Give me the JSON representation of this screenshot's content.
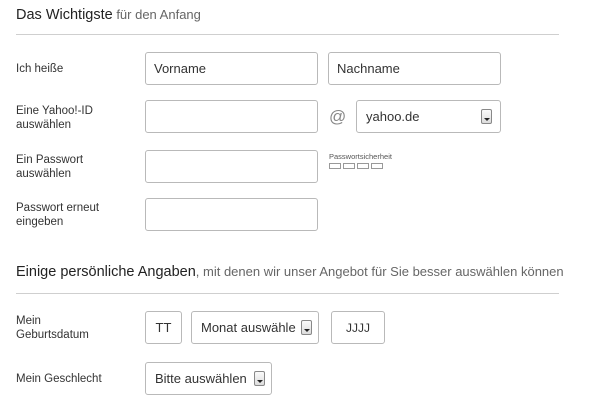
{
  "section1": {
    "title_strong": "Das Wichtigste",
    "title_sub": " für den Anfang"
  },
  "name_row": {
    "label": "Ich heiße",
    "firstname_placeholder": "Vorname",
    "lastname_placeholder": "Nachname"
  },
  "yahoo_row": {
    "label_line1": "Eine Yahoo!-ID",
    "label_line2": "auswählen",
    "at_symbol": "@",
    "domain_value": "yahoo.de"
  },
  "password_row": {
    "label_line1": "Ein Passwort",
    "label_line2": "auswählen",
    "strength_label": "Passwortsicherheit"
  },
  "password_confirm_row": {
    "label_line1": "Passwort erneut",
    "label_line2": "eingeben"
  },
  "section2": {
    "title_strong": "Einige persönliche Angaben",
    "title_sub": ", mit denen wir unser Angebot für Sie besser auswählen können"
  },
  "birthday_row": {
    "label_line1": "Mein",
    "label_line2": "Geburtsdatum",
    "day_placeholder": "TT",
    "month_value": "Monat auswähle",
    "year_placeholder": "JJJJ"
  },
  "gender_row": {
    "label": "Mein Geschlecht",
    "gender_value": "Bitte auswählen"
  }
}
